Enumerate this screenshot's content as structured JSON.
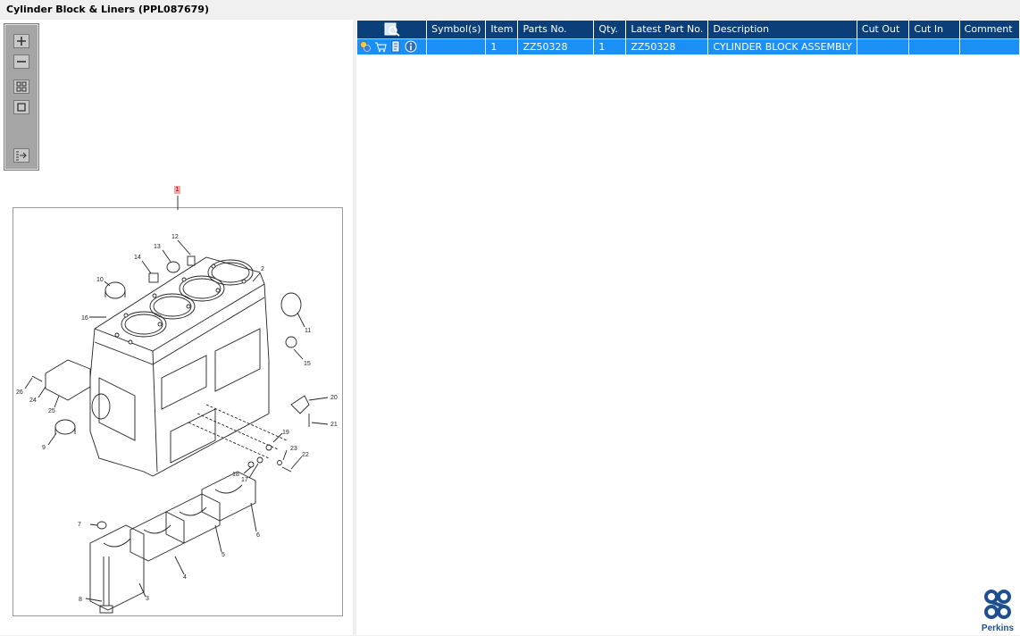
{
  "window": {
    "title": "Cylinder Block & Liners (PPL087679)"
  },
  "toolbar": {
    "buttons": [
      {
        "icon": "zoom-in-icon"
      },
      {
        "icon": "zoom-out-icon"
      },
      {
        "icon": "fit-all-icon"
      },
      {
        "icon": "actual-size-icon"
      },
      {
        "icon": "export-list-icon"
      }
    ]
  },
  "drawing": {
    "highlight_label": "1",
    "callouts": [
      "12",
      "13",
      "14",
      "2",
      "10",
      "16",
      "11",
      "15",
      "26",
      "24",
      "25",
      "20",
      "21",
      "9",
      "19",
      "23",
      "22",
      "18",
      "17",
      "7",
      "6",
      "5",
      "4",
      "8",
      "3"
    ]
  },
  "table": {
    "columns": [
      "Symbol(s)",
      "Item",
      "Parts No.",
      "Qty.",
      "Latest Part No.",
      "Description",
      "Cut Out",
      "Cut In",
      "Comment"
    ],
    "header_icon": "search-list-icon",
    "rows": [
      {
        "icons": [
          "status-icon",
          "cart-icon",
          "document-icon",
          "info-icon"
        ],
        "symbols": "",
        "item": "1",
        "parts_no": "ZZ50328",
        "qty": "1",
        "latest_part_no": "ZZ50328",
        "description": "CYLINDER BLOCK ASSEMBLY",
        "cut_out": "",
        "cut_in": "",
        "comment": ""
      }
    ]
  },
  "brand": {
    "name": "Perkins",
    "color": "#1d4f91"
  },
  "colors": {
    "header": "#0a3f7a",
    "selected_row": "#1a8ff5",
    "highlight": "#f3a6a6"
  }
}
